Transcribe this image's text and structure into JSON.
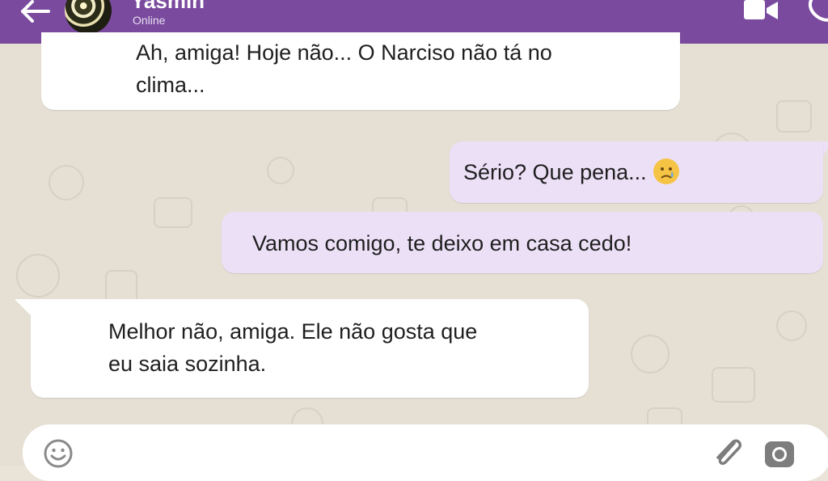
{
  "header": {
    "contact_name": "Yasmin",
    "status": "Online",
    "color": "#7a4a9e"
  },
  "messages": [
    {
      "direction": "in",
      "text_line1": "Ah, amiga! Hoje não... O Narciso não tá no",
      "text_line2": "clima..."
    },
    {
      "direction": "out",
      "text": "Sério? Que pena...",
      "emoji": "sad-crying-face"
    },
    {
      "direction": "out",
      "text": "Vamos comigo, te deixo em casa cedo!"
    },
    {
      "direction": "in",
      "text_line1": "Melhor não, amiga. Ele não gosta que",
      "text_line2": "eu saia sozinha."
    }
  ],
  "composer": {
    "placeholder": "",
    "icons": [
      "emoji-icon",
      "paperclip-icon",
      "camera-icon"
    ]
  },
  "colors": {
    "incoming_bubble": "#ffffff",
    "outgoing_bubble": "#ece0f7",
    "chat_background": "#e6e0d4"
  }
}
